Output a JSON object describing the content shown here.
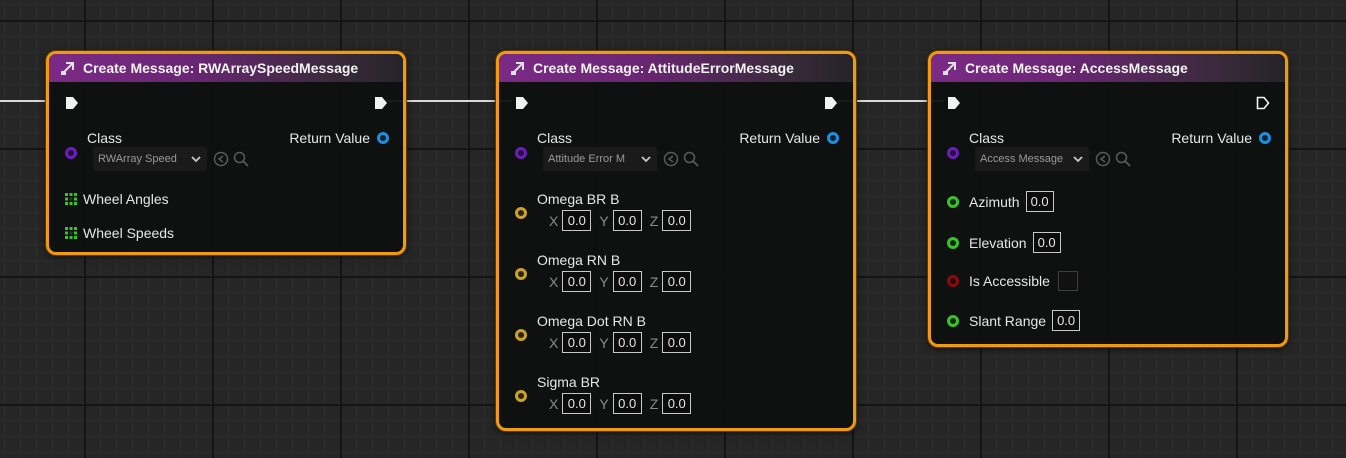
{
  "nodes": [
    {
      "title": "Create Message: RWArraySpeedMessage",
      "class_label": "Class",
      "class_value": "RWArray Speed",
      "return_label": "Return Value",
      "inputs": [
        "Wheel Angles",
        "Wheel Speeds"
      ]
    },
    {
      "title": "Create Message: AttitudeErrorMessage",
      "class_label": "Class",
      "class_value": "Attitude Error M",
      "return_label": "Return Value",
      "vectors": [
        {
          "label": "Omega BR B",
          "x": "0.0",
          "y": "0.0",
          "z": "0.0"
        },
        {
          "label": "Omega RN B",
          "x": "0.0",
          "y": "0.0",
          "z": "0.0"
        },
        {
          "label": "Omega Dot RN B",
          "x": "0.0",
          "y": "0.0",
          "z": "0.0"
        },
        {
          "label": "Sigma BR",
          "x": "0.0",
          "y": "0.0",
          "z": "0.0"
        }
      ],
      "axes": {
        "x": "X",
        "y": "Y",
        "z": "Z"
      }
    },
    {
      "title": "Create Message: AccessMessage",
      "class_label": "Class",
      "class_value": "Access Message",
      "return_label": "Return Value",
      "fields": [
        {
          "label": "Azimuth",
          "value": "0.0"
        },
        {
          "label": "Elevation",
          "value": "0.0"
        },
        {
          "label": "Is Accessible",
          "value": ""
        },
        {
          "label": "Slant Range",
          "value": "0.0"
        }
      ]
    }
  ],
  "icons": {
    "header": "function-icon",
    "exec": "exec-pin-icon",
    "browse": "use-selected-icon",
    "search": "search-icon",
    "chevron": "chevron-down-icon",
    "array": "array-pin-icon"
  },
  "colors": {
    "node_border": "#f09a12",
    "header": "#7b2a86",
    "class_pin": "#6a1ebd",
    "struct_pin": "#1a8fe0",
    "vector_pin": "#c9a22a",
    "float_pin": "#37c424",
    "bool_pin": "#8a0c0c",
    "array_pin": "#37c424"
  }
}
